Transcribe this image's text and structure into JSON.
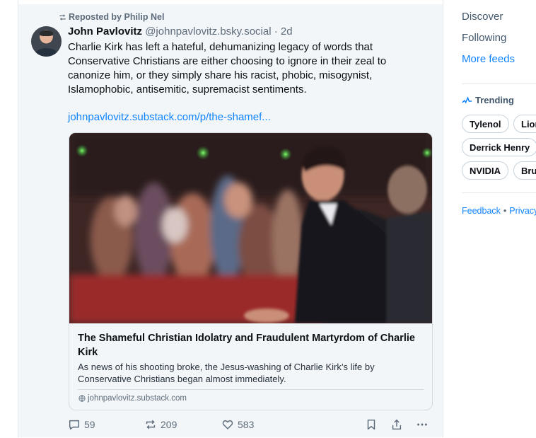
{
  "post": {
    "repost_label": "Reposted by Philip Nel",
    "author_name": "John Pavlovitz",
    "author_handle": "@johnpavlovitz.bsky.social",
    "separator": "·",
    "age": "2d",
    "text": "Charlie Kirk has left a hateful, dehumanizing legacy of words that Conservative Christians are either choosing to ignore in their zeal to canonize him, or they simply share his racist, phobic, misogynist, Islamophobic, antisemitic, supremacist sentiments.",
    "link_text": "johnpavlovitz.substack.com/p/the-shamef...",
    "embed": {
      "title": "The Shameful Christian Idolatry and Fraudulent Martyrdom of Charlie Kirk",
      "description": "As news of his shooting broke, the Jesus-washing of Charlie Kirk’s life by Conservative Christians began almost immediately.",
      "domain": "johnpavlovitz.substack.com"
    },
    "actions": {
      "replies": "59",
      "reposts": "209",
      "likes": "583"
    }
  },
  "sidebar": {
    "feeds": [
      {
        "label": "Discover",
        "active": false
      },
      {
        "label": "Following",
        "active": false
      },
      {
        "label": "More feeds",
        "active": true
      }
    ],
    "trending_title": "Trending",
    "trending_chips": [
      "Tylenol",
      "Lion",
      "Derrick Henry",
      "NVIDIA",
      "Bru"
    ],
    "footer": [
      "Feedback",
      "•",
      "Privacy"
    ]
  },
  "colors": {
    "accent": "#1083fe",
    "muted": "#5d6c7a",
    "border": "#e3e8ed",
    "card_background": "#f3f6f9"
  },
  "icons": [
    "repost-icon",
    "reply-icon",
    "repost-icon",
    "like-icon",
    "bookmark-icon",
    "share-icon",
    "more-options-icon",
    "globe-icon",
    "trending-icon"
  ]
}
